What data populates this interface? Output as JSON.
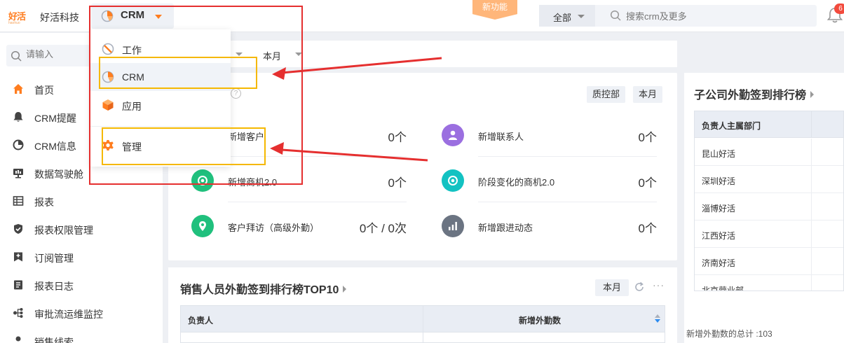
{
  "header": {
    "logo_text": "好活",
    "logo_subtext": "haohuo",
    "company_name": "好活科技",
    "app_switch_label": "CRM",
    "new_feature_label": "新功能",
    "search_scope": "全部",
    "search_placeholder": "搜索crm及更多",
    "notification_badge": "6"
  },
  "sidebar": {
    "search_placeholder": "请输入",
    "items": [
      {
        "label": "首页",
        "icon": "home-icon"
      },
      {
        "label": "CRM提醒",
        "icon": "bell-icon"
      },
      {
        "label": "CRM信息",
        "icon": "pie-chart-icon"
      },
      {
        "label": "数据驾驶舱",
        "icon": "dashboard-icon"
      },
      {
        "label": "报表",
        "icon": "table-icon"
      },
      {
        "label": "报表权限管理",
        "icon": "shield-check-icon"
      },
      {
        "label": "订阅管理",
        "icon": "subscribe-icon"
      },
      {
        "label": "报表日志",
        "icon": "log-icon"
      },
      {
        "label": "审批流运维监控",
        "icon": "flow-icon"
      },
      {
        "label": "销售线索",
        "icon": "leads-icon"
      }
    ]
  },
  "dropdown": {
    "items": [
      {
        "label": "工作",
        "icon": "work-icon"
      },
      {
        "label": "CRM",
        "icon": "crm-pie-icon"
      },
      {
        "label": "应用",
        "icon": "apps-cube-icon"
      },
      {
        "label": "管理",
        "icon": "gear-icon"
      }
    ]
  },
  "filters": {
    "period": "本月"
  },
  "stats": {
    "chips": [
      "质控部",
      "本月"
    ],
    "items": [
      {
        "label": "新增客户",
        "value": "0个",
        "icon": "customer-icon"
      },
      {
        "label": "新增联系人",
        "value": "0个",
        "icon": "contact-icon"
      },
      {
        "label": "新增商机2.0",
        "value": "0个",
        "icon": "opportunity-icon"
      },
      {
        "label": "阶段变化的商机2.0",
        "value": "0个",
        "icon": "stage-opportunity-icon"
      },
      {
        "label": "客户拜访（高级外勤）",
        "value": "0个 / 0次",
        "icon": "visit-icon"
      },
      {
        "label": "新增跟进动态",
        "value": "0个",
        "icon": "follow-up-icon"
      }
    ]
  },
  "branch_ranking": {
    "title": "子公司外勤签到排行榜",
    "column_header": "负责人主属部门",
    "rows": [
      "昆山好活",
      "深圳好活",
      "淄博好活",
      "江西好活",
      "济南好活",
      "北京营业部"
    ],
    "footer": "新增外勤数的总计 :103"
  },
  "sales_ranking": {
    "title": "销售人员外勤签到排行榜TOP10",
    "period_chip": "本月",
    "more": "···",
    "columns": [
      "负责人",
      "新增外勤数"
    ]
  },
  "colors": {
    "brand_orange": "#ff7d1f",
    "annotation_red": "#e52f2f",
    "annotation_yellow": "#f5b800",
    "teal": "#13c2c2",
    "green": "#20c07d",
    "purple": "#9b6fe0",
    "slate": "#6b7482"
  }
}
